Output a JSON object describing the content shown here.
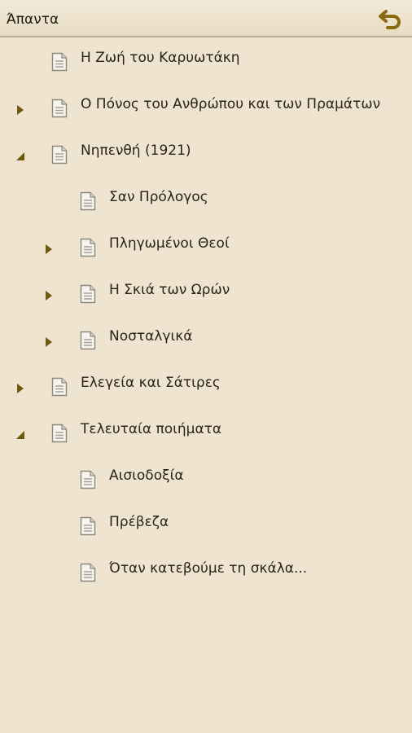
{
  "header": {
    "title": "Άπαντα",
    "back_icon": "undo-arrow-icon",
    "accent": "#8a6d12"
  },
  "tree": [
    {
      "label": "Η Ζωή του Καρυωτάκη",
      "level": 0,
      "state": "leaf"
    },
    {
      "label": "Ο Πόνος του Ανθρώπου και των Πραμάτων",
      "level": 0,
      "state": "collapsed"
    },
    {
      "label": "Νηπενθή (1921)",
      "level": 0,
      "state": "expanded"
    },
    {
      "label": "Σαν Πρόλογος",
      "level": 1,
      "state": "leaf"
    },
    {
      "label": "Πληγωμένοι Θεοί",
      "level": 1,
      "state": "collapsed"
    },
    {
      "label": "Η Σκιά των Ωρών",
      "level": 1,
      "state": "collapsed"
    },
    {
      "label": "Νοσταλγικά",
      "level": 1,
      "state": "collapsed"
    },
    {
      "label": "Ελεγεία και Σάτιρες",
      "level": 0,
      "state": "collapsed"
    },
    {
      "label": "Τελευταία ποιήματα",
      "level": 0,
      "state": "expanded"
    },
    {
      "label": "Αισιοδοξία",
      "level": 1,
      "state": "leaf"
    },
    {
      "label": "Πρέβεζα",
      "level": 1,
      "state": "leaf"
    },
    {
      "label": "Όταν κατεβούμε τη σκάλα...",
      "level": 1,
      "state": "leaf"
    }
  ]
}
